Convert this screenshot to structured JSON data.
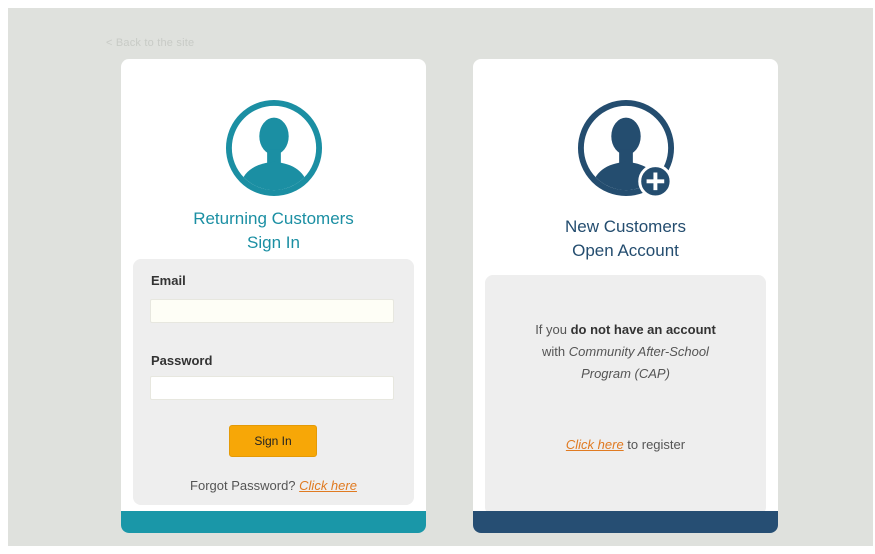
{
  "back_link": {
    "label": "< Back to the site"
  },
  "colors": {
    "teal": "#1b8fa3",
    "navy": "#244d6f",
    "orange": "#f7a707",
    "link": "#e07a21",
    "panel": "#eeeeee",
    "background": "#dfe1dd"
  },
  "returning": {
    "icon": "user-avatar-icon",
    "title_line1": "Returning Customers",
    "title_line2": "Sign In",
    "email_label": "Email",
    "email_value": "",
    "password_label": "Password",
    "password_value": "",
    "sign_in_label": "Sign In",
    "forgot_text": "Forgot Password?",
    "forgot_link": "Click here"
  },
  "new_customers": {
    "icon": "add-user-icon",
    "title_line1": "New Customers",
    "title_line2": "Open Account",
    "info_prefix": "If you",
    "info_bold": "do not have an account",
    "info_with": "with",
    "info_org": "Community After-School Program (CAP)",
    "register_link": "Click here",
    "register_suffix": "to register"
  }
}
